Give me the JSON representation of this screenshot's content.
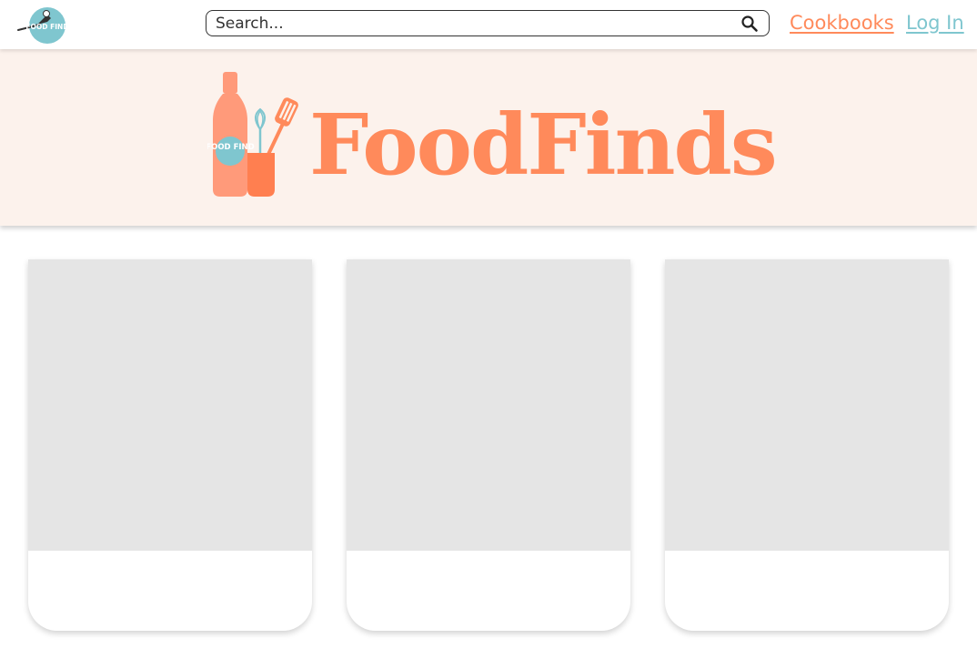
{
  "nav": {
    "logo_text": "FOOD FIND",
    "search_placeholder": "Search...",
    "cookbooks_label": "Cookbooks",
    "login_label": "Log In"
  },
  "banner": {
    "title": "FoodFinds",
    "logo_text": "FOOD FIND"
  },
  "cards": [
    {
      "image": "placeholder",
      "title": ""
    },
    {
      "image": "placeholder",
      "title": ""
    },
    {
      "image": "placeholder",
      "title": ""
    }
  ],
  "colors": {
    "accent": "#ff8a5b",
    "teal": "#7fc6cf",
    "banner_bg": "#fcf2ec",
    "placeholder": "#e5e5e5"
  },
  "icons": [
    "food-find-logo-icon",
    "search-icon",
    "bottle-utensils-icon"
  ]
}
